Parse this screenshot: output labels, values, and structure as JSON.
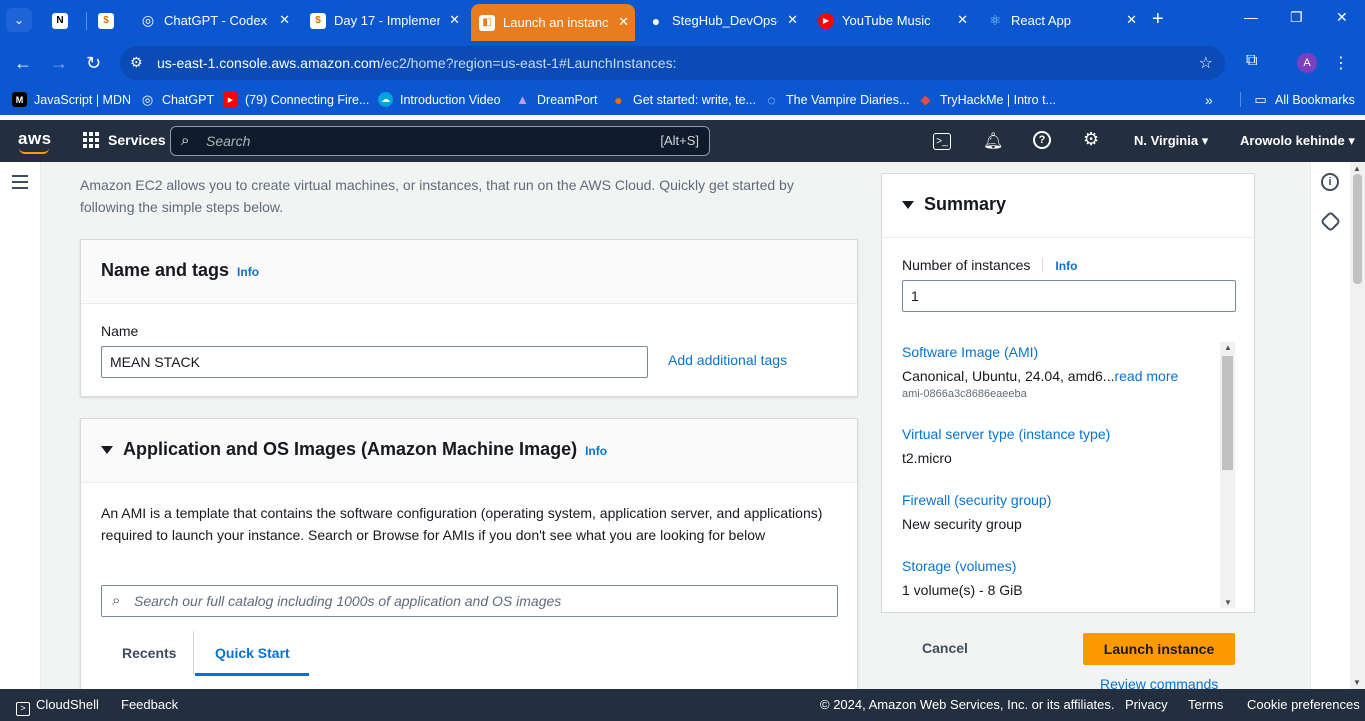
{
  "browser": {
    "tabs": [
      {
        "title": "",
        "fav_color": "#ffffff",
        "fav_text": "N",
        "fav_fg": "#000"
      },
      {
        "title": "",
        "fav_color": "#ffffff",
        "fav_text": "$",
        "fav_fg": "#c77a00"
      },
      {
        "title": "ChatGPT - Codex",
        "fav_color": "#0b57d0",
        "fav_text": "◎",
        "fav_fg": "#fff"
      },
      {
        "title": "Day 17 - Implemen",
        "fav_color": "#ffffff",
        "fav_text": "$",
        "fav_fg": "#c77a00"
      },
      {
        "title": "Launch an instance",
        "fav_color": "#ffffff",
        "fav_text": "◧",
        "fav_fg": "#e97c1e"
      },
      {
        "title": "StegHub_DevOps-",
        "fav_color": "#0b57d0",
        "fav_text": "●",
        "fav_fg": "#fff"
      },
      {
        "title": "YouTube Music",
        "fav_color": "#ff0000",
        "fav_text": "▶",
        "fav_fg": "#fff"
      },
      {
        "title": "React App",
        "fav_color": "#0b57d0",
        "fav_text": "⚛",
        "fav_fg": "#8ad8f5"
      }
    ],
    "url_host": "us-east-1.console.aws.amazon.com",
    "url_path": "/ec2/home?region=us-east-1#LaunchInstances:",
    "profile_initial": "A",
    "bookmarks": [
      {
        "label": "JavaScript | MDN",
        "fav_text": "M",
        "fav_color": "#000000"
      },
      {
        "label": "ChatGPT",
        "fav_text": "◎",
        "fav_color": "#0b57d0"
      },
      {
        "label": "(79) Connecting Fire...",
        "fav_text": "▶",
        "fav_color": "#ff0000"
      },
      {
        "label": "Introduction Video",
        "fav_text": "☁",
        "fav_color": "#00a1e0"
      },
      {
        "label": "DreamPort",
        "fav_text": "▲",
        "fav_color": "#6b4fbb"
      },
      {
        "label": "Get started: write, te...",
        "fav_text": "●",
        "fav_color": "#ff6a00"
      },
      {
        "label": "The Vampire Diaries...",
        "fav_text": "◌",
        "fav_color": "#0b57d0"
      },
      {
        "label": "TryHackMe | Intro t...",
        "fav_text": "◆",
        "fav_color": "#c11f1f"
      }
    ],
    "all_bookmarks": "All Bookmarks"
  },
  "aws": {
    "logo": "aws",
    "services": "Services",
    "search_placeholder": "Search",
    "search_shortcut": "[Alt+S]",
    "region": "N. Virginia",
    "account": "Arowolo kehinde"
  },
  "page": {
    "intro": "Amazon EC2 allows you to create virtual machines, or instances, that run on the AWS Cloud. Quickly get started by following the simple steps below.",
    "name_tags": {
      "title": "Name and tags",
      "info": "Info",
      "name_label": "Name",
      "name_value": "MEAN STACK",
      "add_tags": "Add additional tags"
    },
    "ami": {
      "title": "Application and OS Images (Amazon Machine Image)",
      "info": "Info",
      "description": "An AMI is a template that contains the software configuration (operating system, application server, and applications) required to launch your instance. Search or Browse for AMIs if you don't see what you are looking for below",
      "search_placeholder": "Search our full catalog including 1000s of application and OS images",
      "tabs": [
        "Recents",
        "Quick Start"
      ]
    }
  },
  "summary": {
    "title": "Summary",
    "num_label": "Number of instances",
    "info": "Info",
    "num_value": "1",
    "items": [
      {
        "key": "Software Image (AMI)",
        "value": "Canonical, Ubuntu, 24.04, amd6...",
        "more": "read more",
        "sub": "ami-0866a3c8686eaeeba"
      },
      {
        "key": "Virtual server type (instance type)",
        "value": "t2.micro"
      },
      {
        "key": "Firewall (security group)",
        "value": "New security group"
      },
      {
        "key": "Storage (volumes)",
        "value": "1 volume(s) - 8 GiB"
      }
    ],
    "cancel": "Cancel",
    "launch": "Launch instance",
    "review": "Review commands"
  },
  "footer": {
    "cloudshell": "CloudShell",
    "feedback": "Feedback",
    "copyright": "© 2024, Amazon Web Services, Inc. or its affiliates.",
    "privacy": "Privacy",
    "terms": "Terms",
    "cookies": "Cookie preferences"
  },
  "colors": {
    "chrome_blue": "#0b57d0",
    "aws_header": "#232f3e",
    "aws_link": "#0972d3",
    "launch_orange": "#ff9900"
  }
}
